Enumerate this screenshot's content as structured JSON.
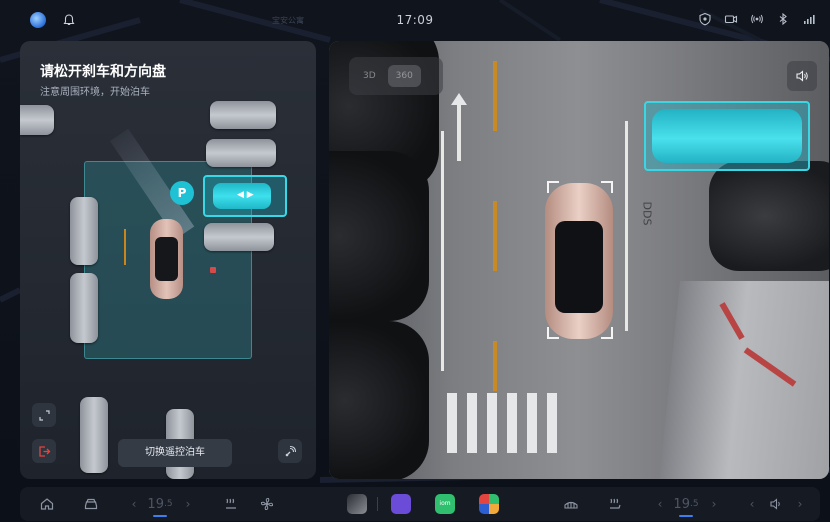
{
  "status_bar": {
    "time": "17:09",
    "map_label": "宝安公寓"
  },
  "parking_panel": {
    "title": "请松开刹车和方向盘",
    "subtitle": "注意周围环境，开始泊车",
    "remote_button_label": "切换遥控泊车",
    "slot_marker": "P"
  },
  "camera_view": {
    "tabs": [
      "3D",
      "360"
    ],
    "active_tab": "360",
    "road_marking": "DDS"
  },
  "dock": {
    "left_temp": "19",
    "right_temp": "19",
    "apps": [
      {
        "name": "music-app",
        "color": "#6a4cd8"
      },
      {
        "name": "iom-app",
        "label": "iom",
        "color": "#2fbf6e"
      },
      {
        "name": "grid-app",
        "color": "#2b5fd1"
      }
    ]
  },
  "colors": {
    "accent_cyan": "#38d8e6",
    "accent_blue": "#3d7ef0",
    "ego_car": "#e2c2b7"
  }
}
